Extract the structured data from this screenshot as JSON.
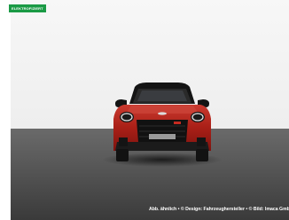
{
  "badge": {
    "label": "ELEKTROFIZIERT",
    "color": "#1a9a45"
  },
  "caption": {
    "text": "Abb. ähnlich • © Design: Fahrzeughersteller • © Bild: Imaca GmbH"
  },
  "image": {
    "subject": "car-photo",
    "colors": {
      "body": "#b4251d",
      "roof": "#111111",
      "studio_wall": "#f5f5f5",
      "floor": "#4a4a4a"
    }
  }
}
